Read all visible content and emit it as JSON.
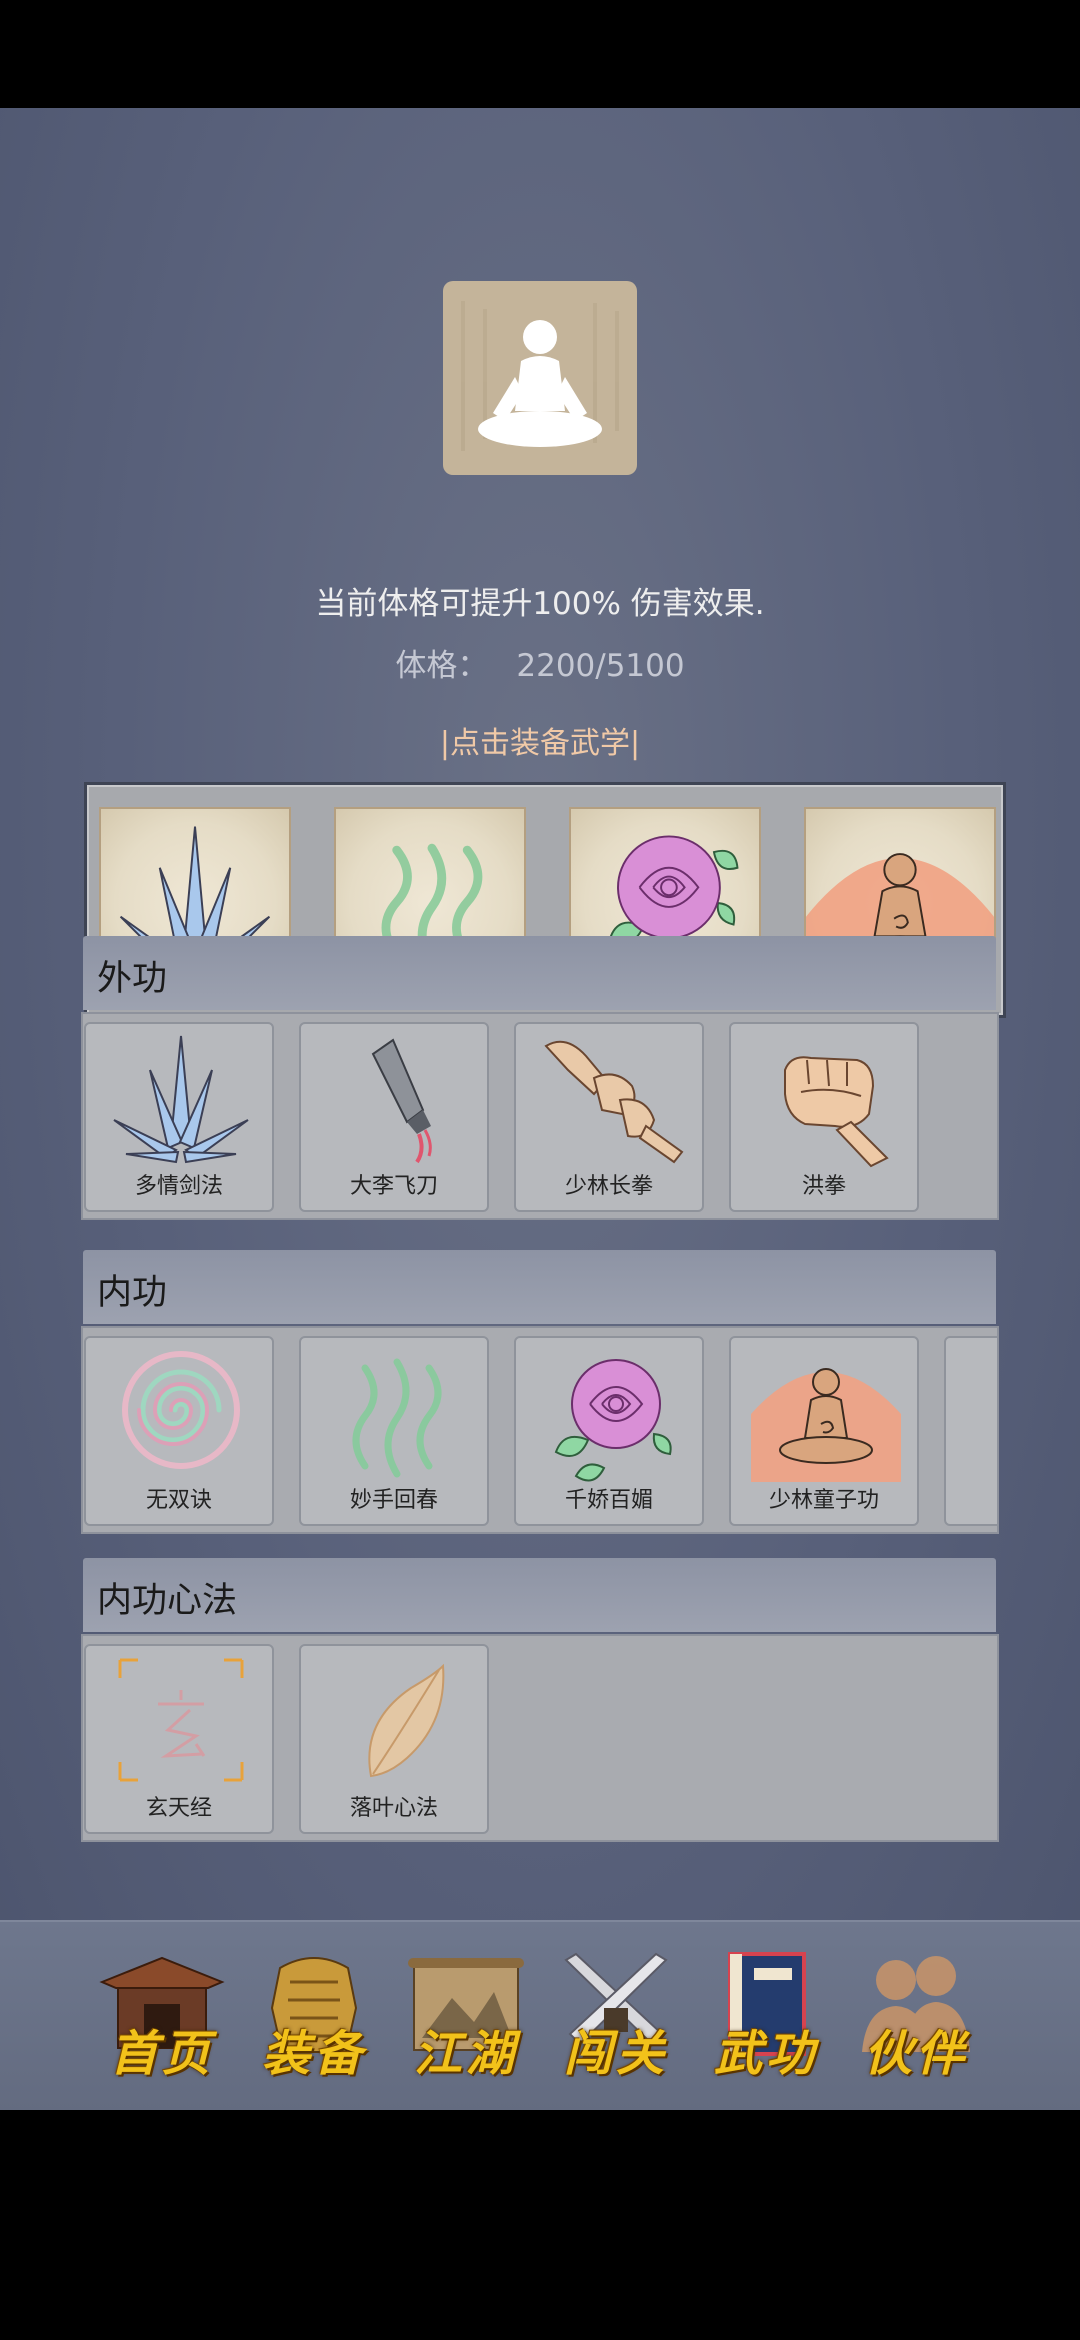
{
  "status": {
    "boost_text": "当前体格可提升100% 伤害效果.",
    "physique_label": "体格：",
    "physique_value": "2200/5100"
  },
  "hint_text": "|点击装备武学|",
  "equipped_slots": [
    {
      "icon": "crystal-blades-icon"
    },
    {
      "icon": "green-aura-icon"
    },
    {
      "icon": "rose-icon"
    },
    {
      "icon": "meditating-monk-icon"
    }
  ],
  "sections": {
    "external": {
      "title": "外功",
      "items": [
        {
          "label": "多情剑法",
          "icon": "crystal-blades-icon"
        },
        {
          "label": "大李飞刀",
          "icon": "flying-knife-icon"
        },
        {
          "label": "少林长拳",
          "icon": "hands-fist-icon"
        },
        {
          "label": "洪拳",
          "icon": "fist-icon"
        }
      ]
    },
    "internal": {
      "title": "内功",
      "items": [
        {
          "label": "无双诀",
          "icon": "spiral-icon"
        },
        {
          "label": "妙手回春",
          "icon": "green-aura-icon"
        },
        {
          "label": "千娇百媚",
          "icon": "rose-icon"
        },
        {
          "label": "少林童子功",
          "icon": "meditating-monk-icon"
        }
      ]
    },
    "mind": {
      "title": "内功心法",
      "items": [
        {
          "label": "玄天经",
          "icon": "xuan-glyph-icon"
        },
        {
          "label": "落叶心法",
          "icon": "leaf-icon"
        }
      ]
    }
  },
  "nav": [
    {
      "label": "首页",
      "icon": "temple-gate-icon"
    },
    {
      "label": "装备",
      "icon": "armor-icon"
    },
    {
      "label": "江湖",
      "icon": "scroll-map-icon"
    },
    {
      "label": "闯关",
      "icon": "crossed-swords-icon"
    },
    {
      "label": "武功",
      "icon": "martial-book-icon"
    },
    {
      "label": "伙伴",
      "icon": "partners-icon"
    }
  ]
}
